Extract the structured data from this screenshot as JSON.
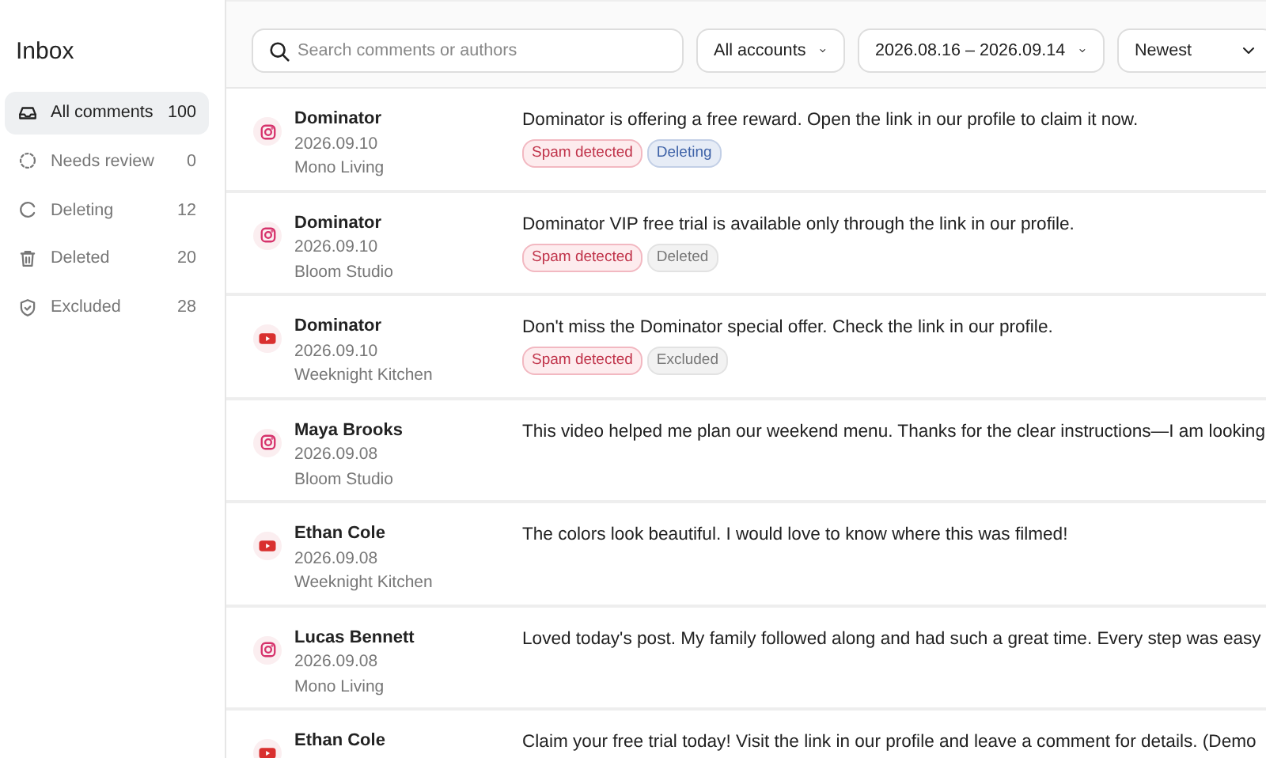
{
  "sidebar": {
    "title": "Inbox",
    "items": [
      {
        "label": "All comments",
        "count": "100",
        "selected": true
      },
      {
        "label": "Needs review",
        "count": "0",
        "selected": false
      },
      {
        "label": "Deleting",
        "count": "12",
        "selected": false
      },
      {
        "label": "Deleted",
        "count": "20",
        "selected": false
      },
      {
        "label": "Excluded",
        "count": "28",
        "selected": false
      }
    ]
  },
  "toolbar": {
    "search": {
      "placeholder": "Search comments or authors"
    },
    "account_filter": "All accounts",
    "date_range": "2026.08.16 – 2026.09.14",
    "sort": "Newest"
  },
  "comments": [
    {
      "kind": "instagram",
      "author": "Dominator",
      "date": "2026.09.10",
      "account": "Mono Living",
      "text": "Dominator is offering a free reward. Open the link in our profile to claim it now.",
      "tags": [
        {
          "label": "Spam detected",
          "kind": "spam"
        },
        {
          "label": "Deleting",
          "kind": "deleting"
        }
      ]
    },
    {
      "kind": "instagram",
      "author": "Dominator",
      "date": "2026.09.10",
      "account": "Bloom Studio",
      "text": "Dominator VIP free trial is available only through the link in our profile.",
      "tags": [
        {
          "label": "Spam detected",
          "kind": "spam"
        },
        {
          "label": "Deleted",
          "kind": "neutral"
        }
      ]
    },
    {
      "kind": "youtube",
      "author": "Dominator",
      "date": "2026.09.10",
      "account": "Weeknight Kitchen",
      "text": "Don't miss the Dominator special offer. Check the link in our profile.",
      "tags": [
        {
          "label": "Spam detected",
          "kind": "spam"
        },
        {
          "label": "Excluded",
          "kind": "neutral"
        }
      ]
    },
    {
      "kind": "instagram",
      "author": "Maya Brooks",
      "date": "2026.09.08",
      "account": "Bloom Studio",
      "text": "This video helped me plan our weekend menu. Thanks for the clear instructions—I am looking"
    },
    {
      "kind": "youtube",
      "author": "Ethan Cole",
      "date": "2026.09.08",
      "account": "Weeknight Kitchen",
      "text": "The colors look beautiful. I would love to know where this was filmed!"
    },
    {
      "kind": "instagram",
      "author": "Lucas Bennett",
      "date": "2026.09.08",
      "account": "Mono Living",
      "text": "Loved today's post. My family followed along and had such a great time. Every step was easy"
    },
    {
      "kind": "youtube",
      "author": "Ethan Cole",
      "text": "Claim your free trial today! Visit the link in our profile and leave a comment for details. (Demo"
    }
  ]
}
